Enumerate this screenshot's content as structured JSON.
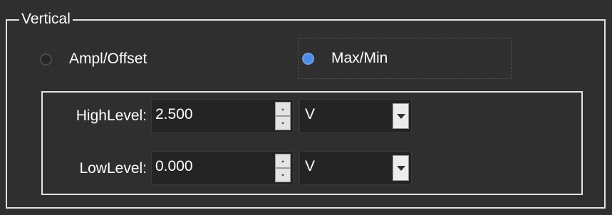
{
  "group": {
    "title": "Vertical"
  },
  "mode": {
    "options": [
      {
        "label": "Ampl/Offset",
        "selected": false
      },
      {
        "label": "Max/Min",
        "selected": true
      }
    ]
  },
  "high_level": {
    "label": "HighLevel:",
    "value": "2.500",
    "unit": "V"
  },
  "low_level": {
    "label": "LowLevel:",
    "value": "0.000",
    "unit": "V"
  },
  "colors": {
    "background": "#2f2f2f",
    "border": "#e3e3e3",
    "field": "#242424",
    "radio_selected": "#4c8ee6"
  }
}
